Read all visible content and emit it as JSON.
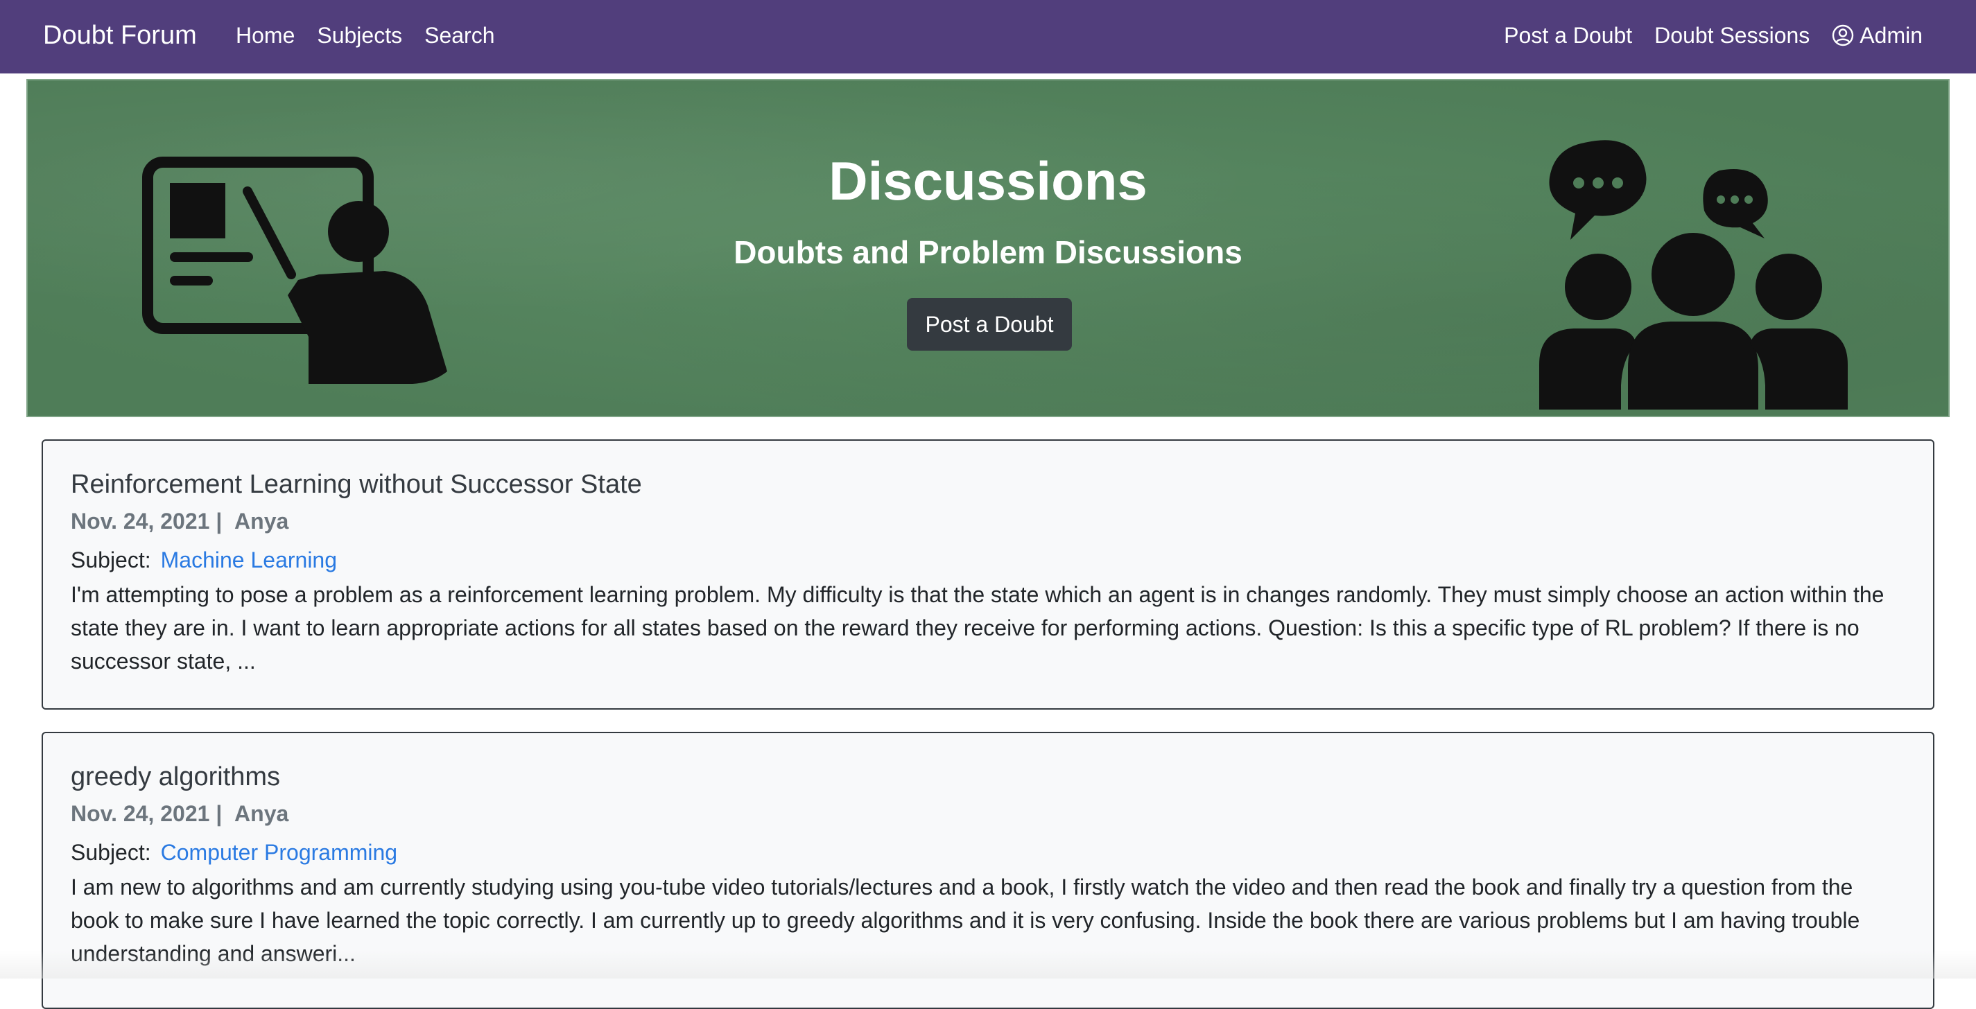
{
  "navbar": {
    "brand": "Doubt Forum",
    "left_links": [
      "Home",
      "Subjects",
      "Search"
    ],
    "right_links": [
      "Post a Doubt",
      "Doubt Sessions"
    ],
    "admin_label": "Admin"
  },
  "hero": {
    "title": "Discussions",
    "subtitle": "Doubts and Problem Discussions",
    "button_label": "Post a Doubt"
  },
  "posts": [
    {
      "title": "Reinforcement Learning without Successor State",
      "date": "Nov. 24, 2021",
      "separator": "|",
      "author": "Anya",
      "subject_label": "Subject:",
      "subject": "Machine Learning",
      "body": "I'm attempting to pose a problem as a reinforcement learning problem. My difficulty is that the state which an agent is in changes randomly. They must simply choose an action within the state they are in. I want to learn appropriate actions for all states based on the reward they receive for performing actions. Question: Is this a specific type of RL problem? If there is no successor state, ..."
    },
    {
      "title": "greedy algorithms",
      "date": "Nov. 24, 2021",
      "separator": "|",
      "author": "Anya",
      "subject_label": "Subject:",
      "subject": "Computer Programming",
      "body": "I am new to algorithms and am currently studying using you-tube video tutorials/lectures and a book, I firstly watch the video and then read the book and finally try a question from the book to make sure I have learned the topic correctly. I am currently up to greedy algorithms and it is very confusing. Inside the book there are various problems but I am having trouble understanding and answeri..."
    }
  ],
  "colors": {
    "navbar_bg": "#513e7c",
    "hero_bg": "#577f5e",
    "button_bg": "#343a40",
    "link": "#2a7ae2",
    "card_bg": "#f8f9fa"
  },
  "icons": {
    "hero_left": "teacher-at-board-icon",
    "hero_right": "group-discussion-icon",
    "admin": "user-circle-icon"
  }
}
